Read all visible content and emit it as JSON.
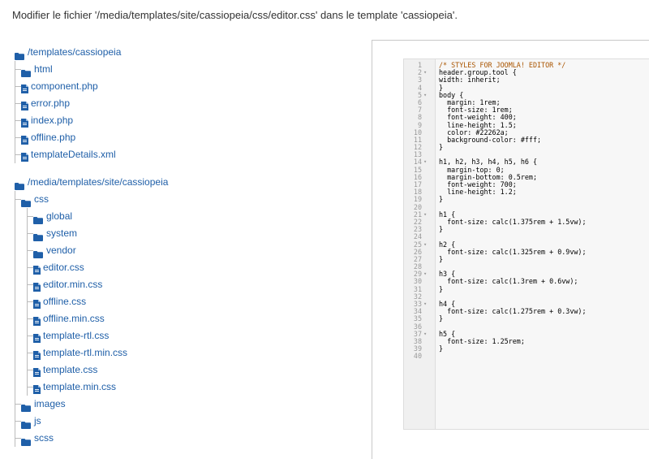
{
  "heading": "Modifier le fichier '/media/templates/site/cassiopeia/css/editor.css' dans le template 'cassiopeia'.",
  "colors": {
    "folder": "#1f5fa8",
    "link": "#1f5fa8"
  },
  "tree1": {
    "root": "/templates/cassiopeia",
    "items": [
      {
        "type": "folder",
        "label": "html"
      },
      {
        "type": "file",
        "label": "component.php"
      },
      {
        "type": "file",
        "label": "error.php"
      },
      {
        "type": "file",
        "label": "index.php"
      },
      {
        "type": "file",
        "label": "offline.php"
      },
      {
        "type": "file",
        "label": "templateDetails.xml"
      }
    ]
  },
  "tree2": {
    "root": "/media/templates/site/cassiopeia",
    "css": "css",
    "css_items": [
      {
        "type": "folder",
        "label": "global"
      },
      {
        "type": "folder",
        "label": "system"
      },
      {
        "type": "folder",
        "label": "vendor"
      },
      {
        "type": "file",
        "label": "editor.css"
      },
      {
        "type": "file",
        "label": "editor.min.css"
      },
      {
        "type": "file",
        "label": "offline.css"
      },
      {
        "type": "file",
        "label": "offline.min.css"
      },
      {
        "type": "file",
        "label": "template-rtl.css"
      },
      {
        "type": "file",
        "label": "template-rtl.min.css"
      },
      {
        "type": "file",
        "label": "template.css"
      },
      {
        "type": "file",
        "label": "template.min.css"
      }
    ],
    "others": [
      "images",
      "js",
      "scss"
    ]
  },
  "code": [
    {
      "n": "1",
      "f": "",
      "t": "/* STYLES FOR JOOMLA! EDITOR */",
      "c": "comment"
    },
    {
      "n": "2",
      "f": "▾",
      "t": "header.group.tool {"
    },
    {
      "n": "3",
      "f": "",
      "t": "width: inherit;"
    },
    {
      "n": "4",
      "f": "",
      "t": "}"
    },
    {
      "n": "5",
      "f": "▾",
      "t": "body {"
    },
    {
      "n": "6",
      "f": "",
      "t": "  margin: 1rem;"
    },
    {
      "n": "7",
      "f": "",
      "t": "  font-size: 1rem;"
    },
    {
      "n": "8",
      "f": "",
      "t": "  font-weight: 400;"
    },
    {
      "n": "9",
      "f": "",
      "t": "  line-height: 1.5;"
    },
    {
      "n": "10",
      "f": "",
      "t": "  color: #22262a;"
    },
    {
      "n": "11",
      "f": "",
      "t": "  background-color: #fff;"
    },
    {
      "n": "12",
      "f": "",
      "t": "}"
    },
    {
      "n": "13",
      "f": "",
      "t": ""
    },
    {
      "n": "14",
      "f": "▾",
      "t": "h1, h2, h3, h4, h5, h6 {"
    },
    {
      "n": "15",
      "f": "",
      "t": "  margin-top: 0;"
    },
    {
      "n": "16",
      "f": "",
      "t": "  margin-bottom: 0.5rem;"
    },
    {
      "n": "17",
      "f": "",
      "t": "  font-weight: 700;"
    },
    {
      "n": "18",
      "f": "",
      "t": "  line-height: 1.2;"
    },
    {
      "n": "19",
      "f": "",
      "t": "}"
    },
    {
      "n": "20",
      "f": "",
      "t": ""
    },
    {
      "n": "21",
      "f": "▾",
      "t": "h1 {"
    },
    {
      "n": "22",
      "f": "",
      "t": "  font-size: calc(1.375rem + 1.5vw);"
    },
    {
      "n": "23",
      "f": "",
      "t": "}"
    },
    {
      "n": "24",
      "f": "",
      "t": ""
    },
    {
      "n": "25",
      "f": "▾",
      "t": "h2 {"
    },
    {
      "n": "26",
      "f": "",
      "t": "  font-size: calc(1.325rem + 0.9vw);"
    },
    {
      "n": "27",
      "f": "",
      "t": "}"
    },
    {
      "n": "28",
      "f": "",
      "t": ""
    },
    {
      "n": "29",
      "f": "▾",
      "t": "h3 {"
    },
    {
      "n": "30",
      "f": "",
      "t": "  font-size: calc(1.3rem + 0.6vw);"
    },
    {
      "n": "31",
      "f": "",
      "t": "}"
    },
    {
      "n": "32",
      "f": "",
      "t": ""
    },
    {
      "n": "33",
      "f": "▾",
      "t": "h4 {"
    },
    {
      "n": "34",
      "f": "",
      "t": "  font-size: calc(1.275rem + 0.3vw);"
    },
    {
      "n": "35",
      "f": "",
      "t": "}"
    },
    {
      "n": "36",
      "f": "",
      "t": ""
    },
    {
      "n": "37",
      "f": "▾",
      "t": "h5 {"
    },
    {
      "n": "38",
      "f": "",
      "t": "  font-size: 1.25rem;"
    },
    {
      "n": "39",
      "f": "",
      "t": "}"
    },
    {
      "n": "40",
      "f": "",
      "t": ""
    }
  ]
}
